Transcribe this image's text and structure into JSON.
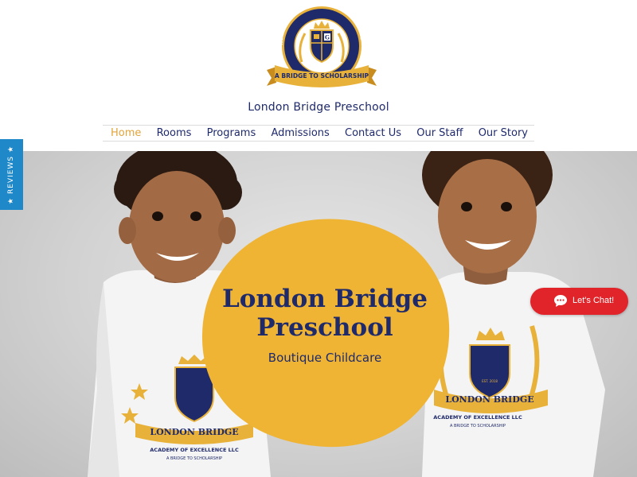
{
  "brand": {
    "logo_ring_text": "LONDON BRIDGE ACADEMY OF EXCELLENCE LLC",
    "logo_ribbon_text": "A BRIDGE TO SCHOLARSHIP",
    "site_name": "London Bridge Preschool",
    "navy": "#1f2a6b",
    "gold": "#e8b23a"
  },
  "nav": {
    "items": [
      {
        "label": "Home",
        "active": true
      },
      {
        "label": "Rooms",
        "active": false
      },
      {
        "label": "Programs",
        "active": false
      },
      {
        "label": "Admissions",
        "active": false
      },
      {
        "label": "Contact Us",
        "active": false
      },
      {
        "label": "Our Staff",
        "active": false
      },
      {
        "label": "Our Story",
        "active": false
      }
    ]
  },
  "hero": {
    "title_line1": "London Bridge",
    "title_line2": "Preschool",
    "subtitle": "Boutique Childcare",
    "shirt_logo_line1": "LONDON BRIDGE",
    "shirt_logo_line2": "ACADEMY OF EXCELLENCE LLC",
    "shirt_logo_line3": "A BRIDGE TO SCHOLARSHIP",
    "shirt_est": "EST. 2018"
  },
  "reviews_tab": {
    "label": "REVIEWS",
    "star": "★",
    "color": "#1e88c8"
  },
  "chat": {
    "label": "Let's Chat!",
    "icon": "chat-bubble-icon",
    "color": "#e1242a"
  }
}
